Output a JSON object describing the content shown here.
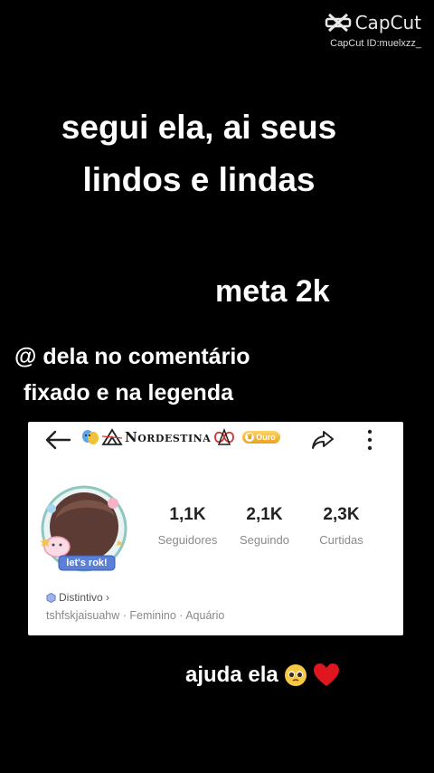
{
  "watermark": {
    "brand": "CapCut",
    "id": "CapCut ID:muelxzz_"
  },
  "captions": {
    "line1": "segui ela, ai seus",
    "line2": "lindos e lindas",
    "meta": "meta 2k",
    "at_line1": "@ dela no comentário",
    "at_line2": "fixado e na legenda",
    "help": "ajuda ela"
  },
  "profile": {
    "username": "Nordestina",
    "badge": "Ouro",
    "avatar_sticker": "let's rok!",
    "stats": [
      {
        "value": "1,1K",
        "label": "Seguidores"
      },
      {
        "value": "2,1K",
        "label": "Seguindo"
      },
      {
        "value": "2,3K",
        "label": "Curtidas"
      }
    ],
    "distintivo": "Distintivo ›",
    "meta_line": "tshfskjaisuahw · Feminino · Aquário"
  },
  "colors": {
    "background": "#000000",
    "card": "#ffffff",
    "heart": "#e0161f",
    "gold": "#e9a21f"
  }
}
